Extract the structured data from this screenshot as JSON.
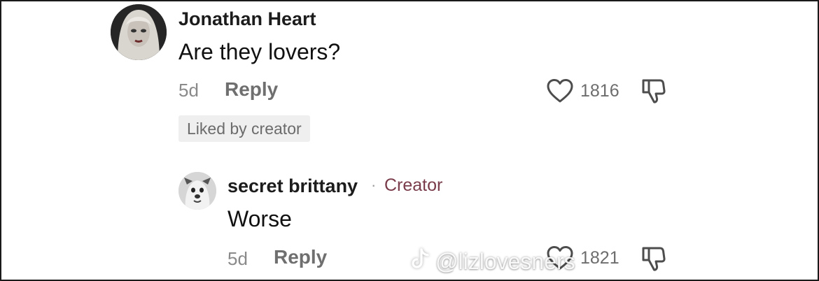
{
  "comment": {
    "author": "Jonathan Heart",
    "text": "Are they lovers?",
    "age": "5d",
    "reply_label": "Reply",
    "likes": "1816",
    "liked_badge": "Liked by creator",
    "icons": {
      "like": "heart-icon",
      "dislike": "thumbs-down-icon"
    }
  },
  "reply": {
    "author": "secret brittany",
    "separator": "·",
    "author_tag": "Creator",
    "text": "Worse",
    "age": "5d",
    "reply_label": "Reply",
    "likes": "1821",
    "icons": {
      "like": "heart-icon",
      "dislike": "thumbs-down-icon"
    }
  },
  "watermark": {
    "icon": "tiktok-logo-icon",
    "handle": "@lizlovesners"
  },
  "colors": {
    "creator_tag": "#7a3c4b",
    "secondary_text": "#8a8a8a",
    "badge_bg": "#efefef"
  }
}
